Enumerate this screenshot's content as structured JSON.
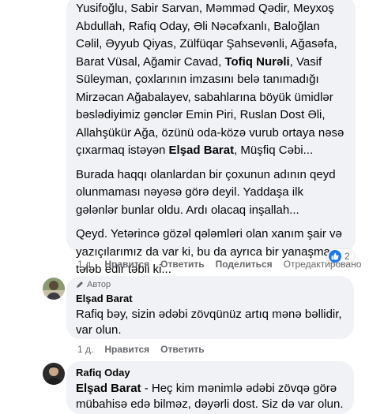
{
  "comment1": {
    "para1": {
      "p1": "Yusifoğlu, Sabir Sarvan, Məmməd Qədir, Meyxoş Abdullah, Rafiq Oday, Əli Nəcəfxanlı, Baloğlan Cəlil, Əyyub Qiyas, Zülfüqar Şahsevənli, Ağasəfa, Barat Vüsal, Ağamir Cavad, ",
      "name1": "Tofiq Nurəli",
      "p2": ", Vasif Süleyman, çoxlarının imzasını belə tanımadığı Mirzəcan Ağabalayev, sabahlarına böyük ümidlər bəslədiyimiz gənclər Emin Piri, Ruslan Dost Əli, Allahşükür Ağa, özünü oda-közə vurub ortaya nəsə çıxarmaq istəyən ",
      "name2": "Elşad Barat",
      "p3": ", Müşfiq Cəbi..."
    },
    "para2": "Burada haqqı olanlardan bir çoxunun adının qeyd olunmaması nəyəsə görə deyil. Yaddaşa ilk gələnlər bunlar oldu. Ardı olacaq inşallah...",
    "para3": "Qeyd. Yetərincə gözəl qələmləri olan xanım şair və yazıçılarımız da var ki, bu da ayrıca bir yanaşma tələb edir təbii ki...",
    "time": "1 д.",
    "like": "Нравится",
    "reply": "Ответить",
    "share": "Поделиться",
    "edited": "Отредактировано",
    "reactions_count": "2"
  },
  "comment2": {
    "badge": "Автор",
    "author": "Elşad Barat",
    "text": "Rafiq bəy, sizin ədəbi zövqünüz artıq mənə bəllidir, var olun.",
    "time": "1 д.",
    "like": "Нравится",
    "reply": "Ответить"
  },
  "comment3": {
    "author": "Rafiq Oday",
    "mention": "Elşad Barat",
    "text": " - Heç kim mənimlə ədəbi zövqə görə mübahisə edə bilməz, dəyərli dost. Siz də var olun."
  },
  "colors": {
    "bubble": "#f0f2f5",
    "like_blue": "#1877f2",
    "meta": "#65676b"
  }
}
